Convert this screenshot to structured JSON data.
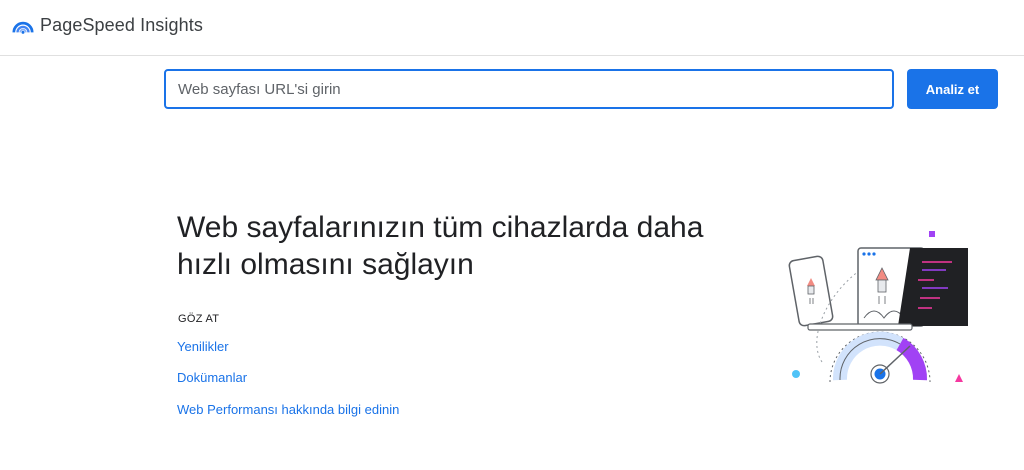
{
  "header": {
    "app_title": "PageSpeed Insights",
    "logo_icon": "pagespeed-gauge-icon"
  },
  "search": {
    "placeholder": "Web sayfası URL'si girin",
    "value": "",
    "button_label": "Analiz et"
  },
  "hero": {
    "title": "Web sayfalarınızın tüm cihazlarda daha hızlı olmasını sağlayın"
  },
  "explore": {
    "heading": "GÖZ AT",
    "links": [
      "Yenilikler",
      "Dokümanlar",
      "Web Performansı hakkında bilgi edinin"
    ]
  },
  "colors": {
    "accent": "#1a73e8",
    "gauge_purple": "#a142f4",
    "gauge_blue": "#1a73e8",
    "gauge_light": "#d2e3fc",
    "decor_pink": "#f538a0",
    "decor_lightblue": "#4fc3f7",
    "code_panel": "#202124"
  }
}
